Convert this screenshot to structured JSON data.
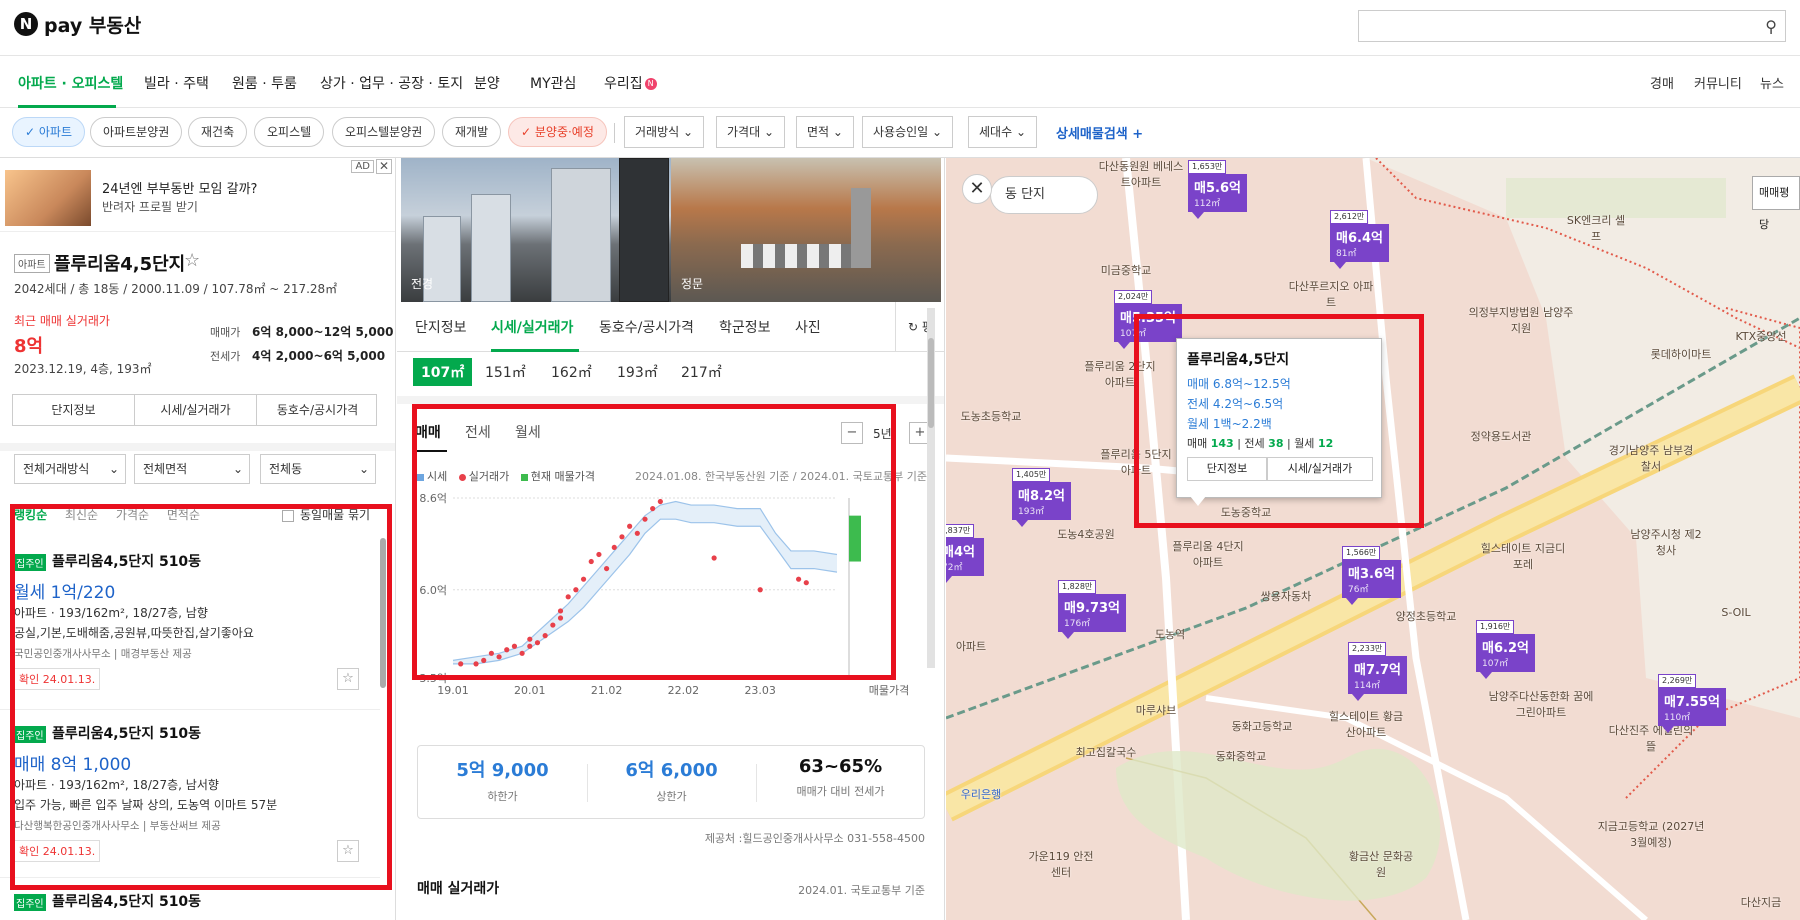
{
  "header": {
    "logo_letter": "N",
    "logo_text": "pay 부동산",
    "search_placeholder": ""
  },
  "nav": {
    "items": [
      "아파트 · 오피스텔",
      "빌라 · 주택",
      "원룸 · 투룸",
      "상가 · 업무 · 공장 · 토지",
      "분양",
      "MY관심",
      "우리집"
    ],
    "new_dot": "N",
    "right": [
      "경매",
      "커뮤니티",
      "뉴스"
    ]
  },
  "filters": {
    "chips": [
      "아파트",
      "아파트분양권",
      "재건축",
      "오피스텔",
      "오피스텔분양권",
      "재개발",
      "분양중·예정"
    ],
    "dropdowns": [
      "거래방식",
      "가격대",
      "면적",
      "사용승인일",
      "세대수"
    ],
    "advanced": "상세매물검색",
    "advanced_plus": "+"
  },
  "ad": {
    "title": "24년엔 부부동반 모임 갈까?",
    "subtitle": "반려자 프로필 받기",
    "badge": "AD",
    "close": "✕"
  },
  "complex": {
    "type": "아파트",
    "name": "플루리움4,5단지",
    "meta": "2042세대 / 총 18동 / 2000.11.09 / 107.78㎡ ~ 217.28㎡",
    "recent_label": "최근 매매 실거래가",
    "recent_price": "8억",
    "recent_date": "2023.12.19, 4층, 193㎡",
    "sale_label": "매매가",
    "sale_range": "6억 8,000~12억 5,000",
    "jeonse_label": "전세가",
    "jeonse_range": "4억 2,000~6억 5,000",
    "tabs": [
      "단지정보",
      "시세/실거래가",
      "동호수/공시가격"
    ]
  },
  "list_filters": [
    "전체거래방식",
    "전체면적",
    "전체동"
  ],
  "sort": {
    "options": [
      "랭킹순",
      "최신순",
      "가격순",
      "면적순"
    ],
    "bundle": "동일매물 묶기"
  },
  "listings": [
    {
      "tag": "집주인",
      "title": "플루리움4,5단지 510동",
      "price": "월세 1억/220",
      "line1": "아파트 · 193/162m², 18/27층, 남향",
      "line2": "공실,기본,도배해줌,공원뷰,따뜻한집,살기좋아요",
      "src": "국민공인중개사사무소  |  매경부동산 제공",
      "date": "확인 24.01.13."
    },
    {
      "tag": "집주인",
      "title": "플루리움4,5단지 510동",
      "price": "매매 8억 1,000",
      "line1": "아파트 · 193/162m², 18/27층, 남서향",
      "line2": "입주 가능, 빠른 입주 날짜 상의, 도농역 이마트 57분",
      "src": "다산행복한공인중개사사무소  |  부동산써브 제공",
      "date": "확인 24.01.13."
    },
    {
      "tag": "집주인",
      "title": "플루리움4,5단지 510동"
    }
  ],
  "photos": [
    "전경",
    "정문"
  ],
  "detail_tabs": [
    "단지정보",
    "시세/실거래가",
    "동호수/공시가격",
    "학군정보",
    "사진"
  ],
  "pyeong_btn": "평",
  "areas": [
    "107㎡",
    "151㎡",
    "162㎡",
    "193㎡",
    "217㎡"
  ],
  "chart_tabs": [
    "매매",
    "전세",
    "월세"
  ],
  "zoom": {
    "minus": "−",
    "value": "5년",
    "plus": "+"
  },
  "legend": [
    "시세",
    "실거래가",
    "현재 매물가격"
  ],
  "chart_source": "2024.01.08. 한국부동산원 기준 / 2024.01. 국토교통부 기준",
  "chart_data": {
    "type": "line",
    "title": "",
    "xlabel": "",
    "ylabel": "",
    "x_ticks": [
      "19.01",
      "20.01",
      "21.02",
      "22.02",
      "23.03"
    ],
    "x_last_label": "매물가격",
    "y_ticks": [
      "3.5억",
      "6.0억",
      "8.6억"
    ],
    "ylim": [
      3.5,
      8.6
    ],
    "xlim": [
      2019.0,
      2024.0
    ],
    "colors": {
      "band": "#9cc3ea",
      "band_fill": "#e4eff9",
      "dots": "#e8404a",
      "current": "#3dbb4e"
    },
    "series": [
      {
        "name": "시세",
        "x": [
          2019.0,
          2019.3,
          2019.6,
          2019.9,
          2020.1,
          2020.3,
          2020.5,
          2020.7,
          2020.9,
          2021.1,
          2021.3,
          2021.5,
          2021.7,
          2021.9,
          2022.1,
          2022.4,
          2022.7,
          2023.0,
          2023.2,
          2023.4,
          2023.7,
          2024.0
        ],
        "low": [
          3.9,
          3.9,
          4.0,
          4.2,
          4.5,
          4.8,
          5.1,
          5.5,
          6.0,
          6.5,
          7.0,
          7.6,
          8.0,
          8.0,
          7.9,
          7.9,
          7.8,
          7.8,
          7.2,
          6.6,
          6.6,
          6.5
        ],
        "high": [
          4.0,
          4.1,
          4.2,
          4.4,
          4.8,
          5.2,
          5.6,
          6.1,
          6.6,
          7.1,
          7.6,
          8.1,
          8.4,
          8.5,
          8.4,
          8.4,
          8.3,
          8.3,
          7.6,
          7.1,
          7.1,
          7.0
        ]
      },
      {
        "name": "실거래가",
        "x": [
          2019.1,
          2019.3,
          2019.4,
          2019.5,
          2019.6,
          2019.7,
          2019.8,
          2019.9,
          2020.0,
          2020.0,
          2020.1,
          2020.2,
          2020.3,
          2020.4,
          2020.4,
          2020.5,
          2020.6,
          2020.7,
          2020.8,
          2020.9,
          2021.0,
          2021.1,
          2021.2,
          2021.3,
          2021.4,
          2021.5,
          2021.6,
          2021.7,
          2022.4,
          2023.0,
          2023.5,
          2023.6
        ],
        "y": [
          3.9,
          3.9,
          4.0,
          4.2,
          4.1,
          4.3,
          4.4,
          4.2,
          4.4,
          4.6,
          4.5,
          4.7,
          5.0,
          5.2,
          5.4,
          5.8,
          6.0,
          6.3,
          6.8,
          7.0,
          6.6,
          7.2,
          7.5,
          7.8,
          7.6,
          8.0,
          8.3,
          8.5,
          6.9,
          6.0,
          6.3,
          6.2
        ]
      },
      {
        "name": "현재 매물가격",
        "low": 6.8,
        "high": 8.1
      }
    ]
  },
  "stats": [
    {
      "value": "5억 9,000",
      "label": "하한가",
      "color": "#2b7cd6"
    },
    {
      "value": "6억 6,000",
      "label": "상한가",
      "color": "#2b7cd6"
    },
    {
      "value": "63~65%",
      "label": "매매가 대비 전세가",
      "color": "#111"
    }
  ],
  "provider": "제공처 :힐드공인중개사사무소 031-558-4500",
  "real_title": "매매 실거래가",
  "real_src": "2024.01. 국토교통부 기준",
  "map": {
    "close": "✕",
    "ctl": "동   단지",
    "type_btn": "매매평당",
    "markers": [
      {
        "count": "1,653만",
        "price": "매5.6억",
        "area": "112㎡"
      },
      {
        "count": "2,612만",
        "price": "매6.4억",
        "area": "81㎡"
      },
      {
        "count": "2,024만",
        "price": "매5.35억",
        "area": "107㎡"
      },
      {
        "count": "1,405만",
        "price": "매8.2억",
        "area": "193㎡"
      },
      {
        "count": "1,837만",
        "price": "매4억",
        "area": "72㎡"
      },
      {
        "count": "1,828만",
        "price": "매9.73억",
        "area": "176㎡"
      },
      {
        "count": "1,566만",
        "price": "매3.6억",
        "area": "76㎡"
      },
      {
        "count": "2,233만",
        "price": "매7.7억",
        "area": "114㎡"
      },
      {
        "count": "1,916만",
        "price": "매6.2억",
        "area": "107㎡"
      },
      {
        "count": "2,269만",
        "price": "매7.55억",
        "area": "110㎡"
      }
    ],
    "labels": [
      "다산동원원 베네스트아파트",
      "SK엔크리 셀프",
      "미금중학교",
      "다산푸르지오 아파트",
      "의정부지방법원 남양주지원",
      "롯데하이마트",
      "도농초등학교",
      "플루리움 2단지아파트",
      "정약용도서관",
      "경기남양주 남부경찰서",
      "플루리움 5단지아파트",
      "도농4호공원",
      "도농중학교",
      "플루리움 4단지아파트",
      "힐스테이트 지금디포레",
      "남양주시청 제2청사",
      "쌍용자동차",
      "양정초등학교",
      "도농역",
      "동화고등학교",
      "힐스테이트 황금산아파트",
      "남양주다산동한화 꿈에그린아파트",
      "마루샤브",
      "최고집칼국수",
      "동화중학교",
      "우리은행",
      "가운119 안전센터",
      "황금산 문화공원",
      "지금고등학교 (2027년3월예정)",
      "다산진주 에일린의뜰",
      "다산지금",
      "S-OIL",
      "KTX중앙선",
      "아파트"
    ],
    "popup": {
      "title": "플루리움4,5단지",
      "sale": "매매 6.8억~12.5억",
      "jeonse": "전세 4.2억~6.5억",
      "wolse": "월세 1백~2.2백",
      "cnt_sale_label": "매매",
      "cnt_sale": "143",
      "cnt_jeonse_label": "전세",
      "cnt_jeonse": "38",
      "cnt_wolse_label": "월세",
      "cnt_wolse": "12",
      "btn1": "단지정보",
      "btn2": "시세/실거래가"
    }
  }
}
